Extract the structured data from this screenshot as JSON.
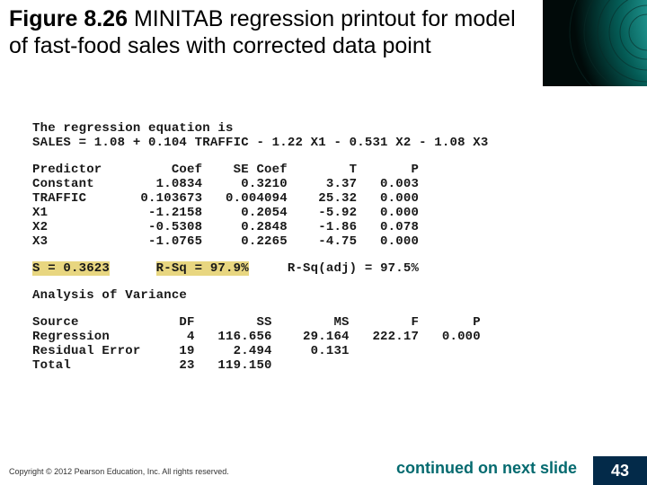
{
  "figure_label": "Figure 8.26",
  "title_rest": "  MINITAB regression printout for model of fast-food sales with corrected data point",
  "regeq_intro": "The regression equation is",
  "regeq": "SALES = 1.08 + 0.104 TRAFFIC - 1.22 X1 - 0.531 X2 - 1.08 X3",
  "coef_header": "Predictor         Coef    SE Coef        T       P",
  "coef_rows": [
    "Constant        1.0834     0.3210     3.37   0.003",
    "TRAFFIC       0.103673   0.004094    25.32   0.000",
    "X1             -1.2158     0.2054    -5.92   0.000",
    "X2             -0.5308     0.2848    -1.86   0.078",
    "X3             -1.0765     0.2265    -4.75   0.000"
  ],
  "stats": {
    "s": "S = 0.3623",
    "rsq": "R-Sq = 97.9%",
    "rsq_adj": "R-Sq(adj) = 97.5%"
  },
  "anova_title": "Analysis of Variance",
  "anova_header": "Source             DF        SS        MS        F       P",
  "anova_rows": [
    "Regression          4   116.656    29.164   222.17   0.000",
    "Residual Error     19     2.494     0.131",
    "Total              23   119.150"
  ],
  "copyright": "Copyright © 2012 Pearson Education, Inc. All rights reserved.",
  "continued": "continued on next slide",
  "page_number": "43",
  "chart_data": {
    "type": "table",
    "title": "MINITAB regression printout for model of fast-food sales with corrected data point",
    "equation": "SALES = 1.08 + 0.104 TRAFFIC - 1.22 X1 - 0.531 X2 - 1.08 X3",
    "coefficients": {
      "columns": [
        "Predictor",
        "Coef",
        "SE Coef",
        "T",
        "P"
      ],
      "rows": [
        [
          "Constant",
          1.0834,
          0.321,
          3.37,
          0.003
        ],
        [
          "TRAFFIC",
          0.103673,
          0.004094,
          25.32,
          0.0
        ],
        [
          "X1",
          -1.2158,
          0.2054,
          -5.92,
          0.0
        ],
        [
          "X2",
          -0.5308,
          0.2848,
          -1.86,
          0.078
        ],
        [
          "X3",
          -1.0765,
          0.2265,
          -4.75,
          0.0
        ]
      ]
    },
    "fit_stats": {
      "S": 0.3623,
      "R_Sq": 0.979,
      "R_Sq_adj": 0.975
    },
    "anova": {
      "columns": [
        "Source",
        "DF",
        "SS",
        "MS",
        "F",
        "P"
      ],
      "rows": [
        [
          "Regression",
          4,
          116.656,
          29.164,
          222.17,
          0.0
        ],
        [
          "Residual Error",
          19,
          2.494,
          0.131,
          null,
          null
        ],
        [
          "Total",
          23,
          119.15,
          null,
          null,
          null
        ]
      ]
    }
  }
}
